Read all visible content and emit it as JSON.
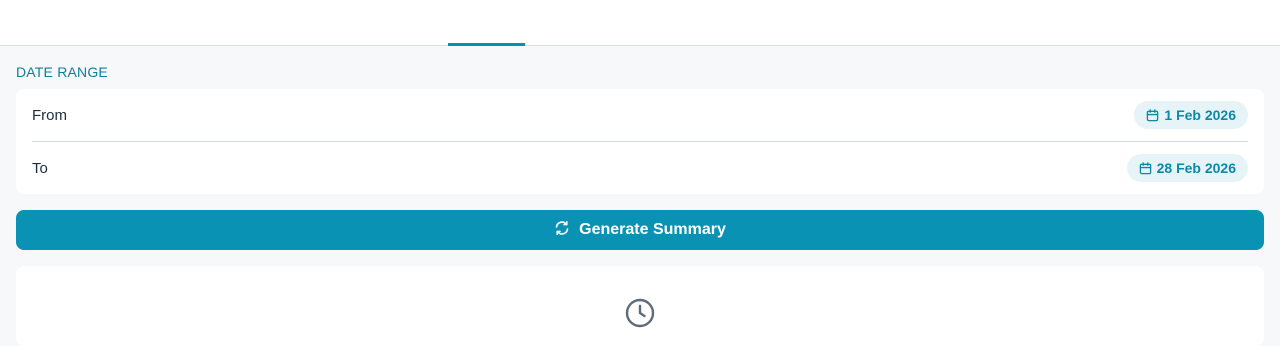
{
  "date_range": {
    "section_label": "DATE RANGE",
    "from": {
      "label": "From",
      "value": "1 Feb 2026",
      "icon": "calendar-icon"
    },
    "to": {
      "label": "To",
      "value": "28 Feb 2026",
      "icon": "calendar-icon"
    }
  },
  "actions": {
    "generate_label": "Generate Summary",
    "generate_icon": "refresh-icon"
  },
  "result": {
    "icon": "clock-icon"
  },
  "colors": {
    "accent": "#0a92b4",
    "chip_bg": "#e6f3f7",
    "chip_text": "#0b89a8",
    "page_bg": "#f6f8fa"
  }
}
